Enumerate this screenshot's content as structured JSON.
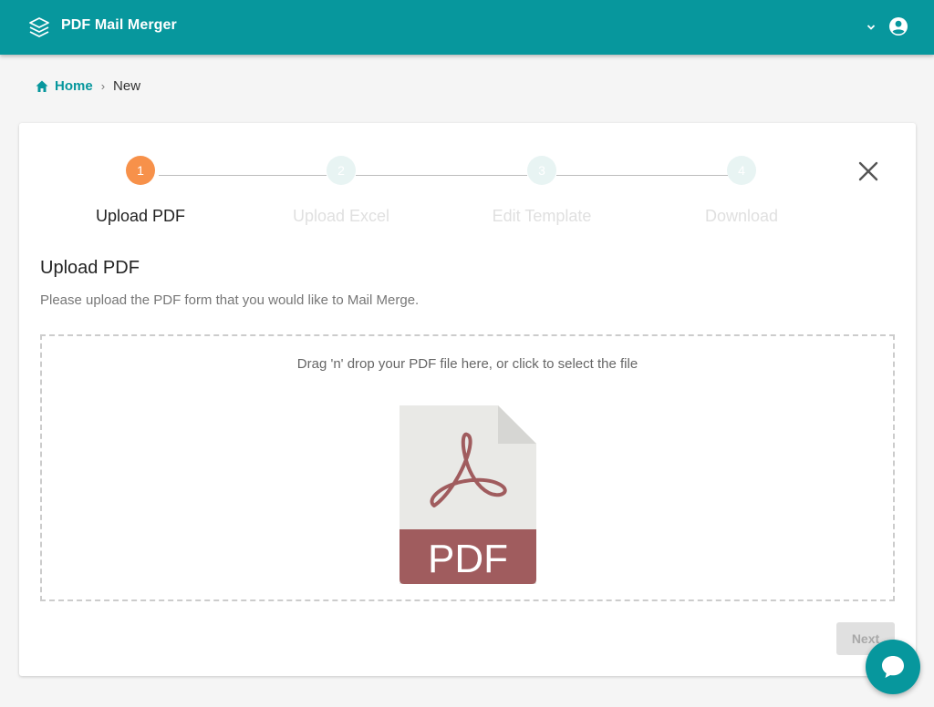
{
  "app": {
    "title": "PDF Mail Merger",
    "logo_icon": "layers-icon",
    "accent": "#07979d"
  },
  "header": {
    "account_chevron_icon": "chevron-down-icon",
    "account_icon": "account-circle-icon"
  },
  "breadcrumb": {
    "home_icon": "home-icon",
    "home_label": "Home",
    "separator": "›",
    "current": "New"
  },
  "stepper": {
    "steps": [
      {
        "number": "1",
        "label": "Upload PDF",
        "state": "active"
      },
      {
        "number": "2",
        "label": "Upload Excel",
        "state": "inactive"
      },
      {
        "number": "3",
        "label": "Edit Template",
        "state": "inactive"
      },
      {
        "number": "4",
        "label": "Download",
        "state": "inactive"
      }
    ],
    "active_color": "#f7914a",
    "close_icon": "close-icon"
  },
  "main": {
    "title": "Upload PDF",
    "description": "Please upload the PDF form that you would like to Mail Merge.",
    "dropzone_text": "Drag 'n' drop your PDF file here, or click to select the file",
    "file_icon_label": "PDF",
    "file_icon": "pdf-file-icon"
  },
  "actions": {
    "next_label": "Next"
  },
  "chat": {
    "icon": "chat-icon"
  }
}
